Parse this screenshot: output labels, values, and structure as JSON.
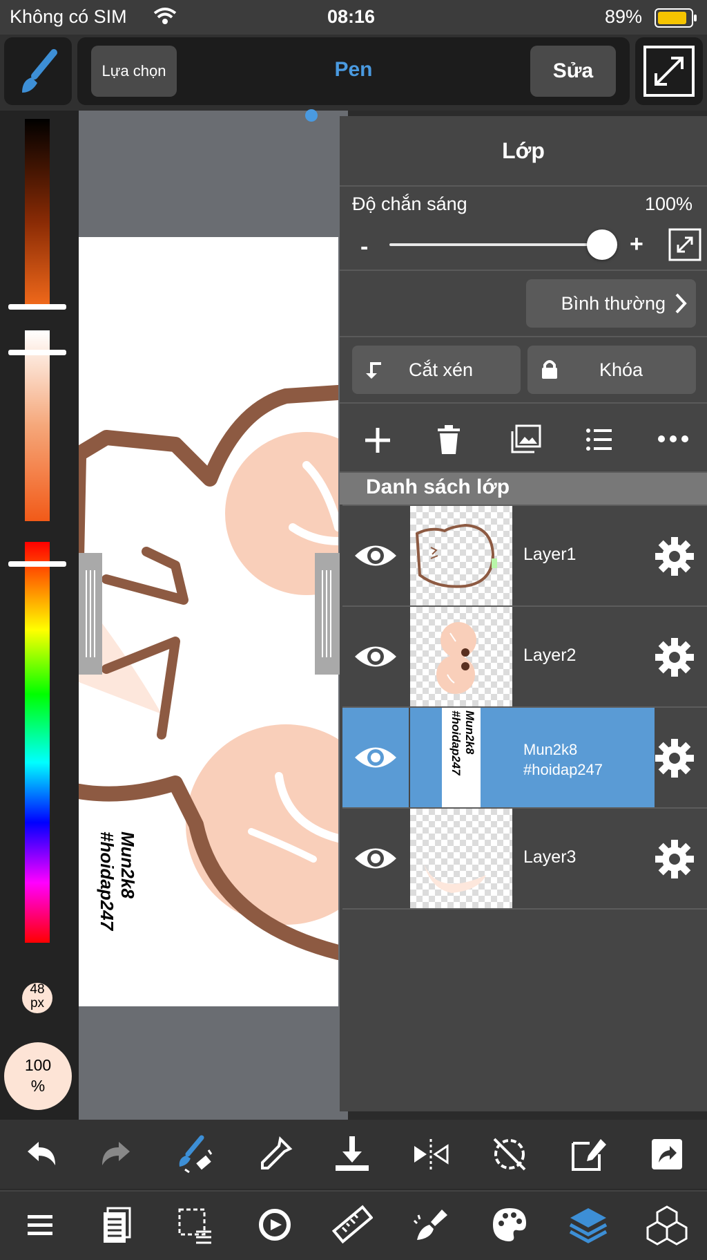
{
  "status_bar": {
    "carrier": "Không có SIM",
    "time": "08:16",
    "battery": "89%"
  },
  "top_bar": {
    "select_label": "Lựa chọn",
    "tool_name": "Pen",
    "edit_label": "Sửa"
  },
  "brush": {
    "size": "48\npx",
    "opacity": "100\n%"
  },
  "canvas": {
    "watermark_line1": "Mun2k8",
    "watermark_line2": "#hoidap247"
  },
  "layer_panel": {
    "title": "Lớp",
    "opacity_label": "Độ chắn sáng",
    "opacity_value": "100%",
    "opacity_level": 1.0,
    "minus": "-",
    "plus": "+",
    "blend_mode": "Bình thường",
    "clip_label": "Cắt xén",
    "lock_label": "Khóa",
    "list_header": "Danh sách lớp",
    "layers": [
      {
        "name": "Layer1",
        "selected": false
      },
      {
        "name": "Layer2",
        "selected": false
      },
      {
        "name": "Mun2k8\n#hoidap247",
        "selected": true,
        "thumb_text": "Mun2k8\n#hoidap247"
      },
      {
        "name": "Layer3",
        "selected": false
      }
    ]
  },
  "colors": {
    "accent": "#4a9ae0",
    "selected_layer": "#5a9bd5",
    "brush_brown": "#8d5a42",
    "skin": "#f9cfba"
  }
}
